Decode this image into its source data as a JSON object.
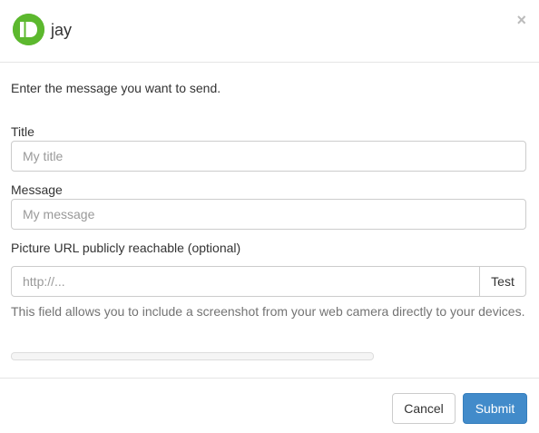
{
  "header": {
    "title": "jay",
    "close_symbol": "×",
    "logo_icon": "pushbullet-logo-icon",
    "logo_color": "#5cb82e"
  },
  "body": {
    "intro": "Enter the message you want to send.",
    "title_label": "Title",
    "title_placeholder": "My title",
    "message_label": "Message",
    "message_placeholder": "My message",
    "picture_label": "Picture URL publicly reachable (optional)",
    "picture_placeholder": "http://...",
    "test_label": "Test",
    "help_text": "This field allows you to include a screenshot from your web camera directly to your devices.",
    "progress": 0
  },
  "footer": {
    "cancel_label": "Cancel",
    "submit_label": "Submit",
    "submit_color": "#428bca"
  }
}
